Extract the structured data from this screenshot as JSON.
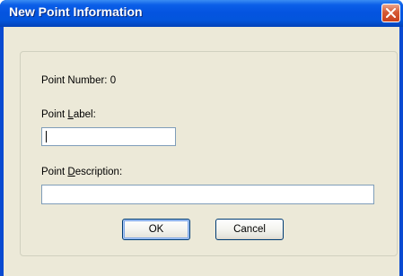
{
  "dialog": {
    "title": "New Point Information"
  },
  "form": {
    "point_number_label": "Point Number: 0",
    "point_label_label": "Point Label:",
    "point_label_value": "",
    "point_description_label": "Point Description:",
    "point_description_value": ""
  },
  "buttons": {
    "ok_label": "OK",
    "cancel_label": "Cancel"
  },
  "colors": {
    "titlebar": "#0454e0",
    "close_button": "#d65a35",
    "dialog_background": "#ece9d8"
  },
  "icons": {
    "close": "close-icon"
  }
}
